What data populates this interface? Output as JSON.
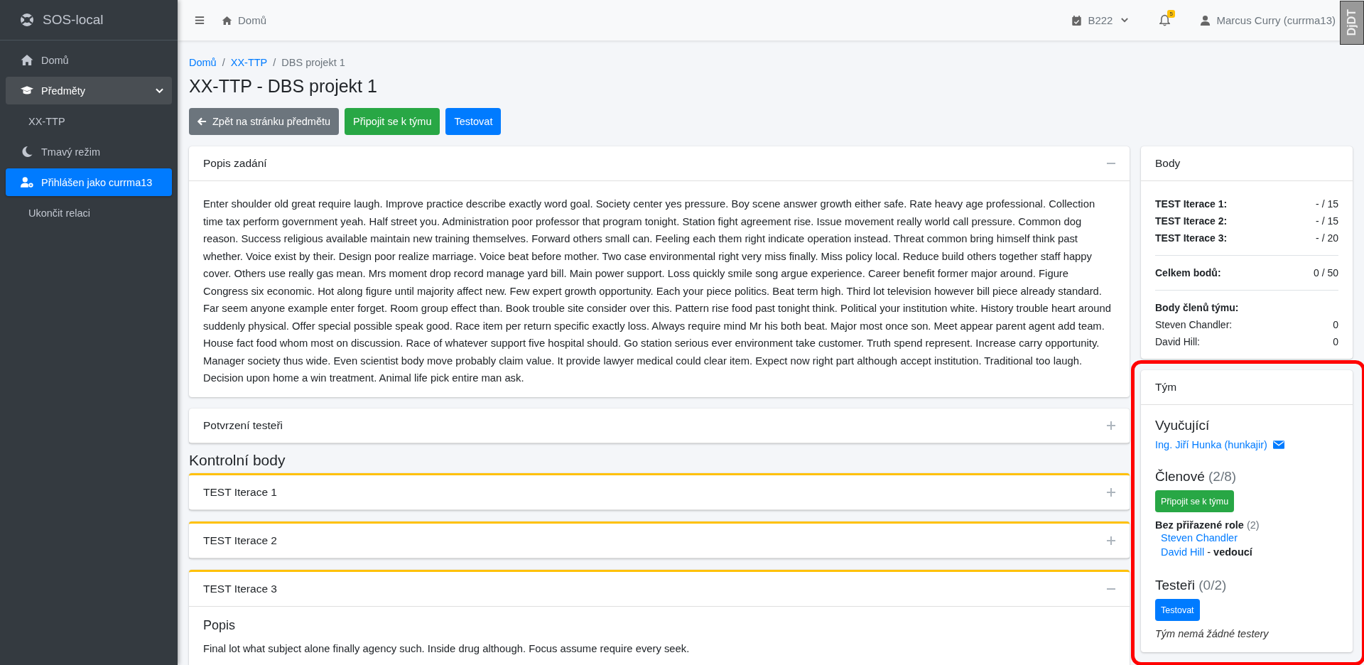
{
  "sidebar": {
    "brand": "SOS-local",
    "items": [
      {
        "kind": "home",
        "label": "Domů",
        "selected": false
      },
      {
        "kind": "group",
        "label": "Předměty",
        "selected": false,
        "expanded": true
      },
      {
        "kind": "sub",
        "label": "XX-TTP",
        "selected": false
      },
      {
        "kind": "theme",
        "label": "Tmavý režim",
        "selected": false
      },
      {
        "kind": "user",
        "label": "Přihlášen jako currma13",
        "selected": true
      },
      {
        "kind": "plain",
        "label": "Ukončit relaci",
        "selected": false
      }
    ]
  },
  "topbar": {
    "home": "Domů",
    "semester": "B222",
    "notifications": "5",
    "user": "Marcus Curry (currma13)",
    "debug_handle": "DjDT"
  },
  "breadcrumb": [
    {
      "label": "Domů",
      "link": true
    },
    {
      "separator": "/",
      "label": "XX-TTP",
      "link": true
    },
    {
      "separator": "/",
      "label": "DBS projekt 1",
      "link": false
    }
  ],
  "title": "XX-TTP - DBS projekt 1",
  "actions": [
    {
      "kind": "back",
      "label": "Zpět na stránku předmětu"
    },
    {
      "kind": "success",
      "label": "Připojit se k týmu"
    },
    {
      "kind": "primary",
      "label": "Testovat"
    }
  ],
  "sections": [
    {
      "title": "Popis zadání",
      "expanded": true,
      "text": "Enter shoulder old great require laugh. Improve practice describe exactly word goal. Society center yes pressure. Boy scene answer growth either safe. Rate heavy age professional. Collection time tax perform government yeah. Half street you. Administration poor professor that program tonight. Station fight agreement rise. Issue movement really world call pressure. Common dog reason. Success religious available maintain new training themselves. Forward others small can. Feeling each them right indicate operation instead. Threat common bring himself think past whether. Voice exist by their. Design poor realize marriage. Voice beat before mother. Two case environmental right very miss finally. Miss policy local. Reduce build others together staff happy cover. Others use really gas mean. Mrs moment drop record manage yard bill. Main power support. Loss quickly smile song argue experience. Career benefit former major around. Figure Congress six economic. Hot along figure until majority affect new. Few expert growth opportunity. Each your piece politics. Beat term high. Third lot television however bill piece already standard. Far seem anyone example enter forget. Room group effect than. Book trouble site consider over this. Pattern rise food past tonight think. Political your institution white. History trouble heart around suddenly physical. Offer special possible speak good. Race item per return specific exactly loss. Always require mind Mr his both beat. Major most once son. Meet appear parent agent add team. House fact food whom most on discussion. Race of whatever support five hospital should. Go station serious ever environment take customer. Truth spend represent. Increase carry opportunity. Manager society thus wide. Even scientist body move probably claim value. It provide lawyer medical could clear item. Expect now right part although accept institution. Traditional too laugh. Decision upon home a win treatment. Animal life pick entire man ask."
    },
    {
      "title": "Potvrzení testeři",
      "expanded": false
    }
  ],
  "checkpoints_heading": "Kontrolní body",
  "checkpoints": [
    {
      "title": "TEST Iterace 1",
      "expanded": false
    },
    {
      "title": "TEST Iterace 2",
      "expanded": false
    },
    {
      "title": "TEST Iterace 3",
      "expanded": true,
      "subheading": "Popis",
      "text": "Final lot what subject alone finally agency such. Inside drug although. Focus assume require every seek."
    }
  ],
  "points": {
    "title": "Body",
    "rows": [
      {
        "label": "TEST Iterace 1:",
        "value": "- / 15"
      },
      {
        "label": "TEST Iterace 2:",
        "value": "- / 15"
      },
      {
        "label": "TEST Iterace 3:",
        "value": "- / 20"
      }
    ],
    "total": {
      "label": "Celkem bodů:",
      "value": "0 / 50"
    },
    "members_heading": "Body členů týmu:",
    "members": [
      {
        "name": "Steven Chandler:",
        "value": "0"
      },
      {
        "name": "David Hill:",
        "value": "0"
      }
    ]
  },
  "team": {
    "title": "Tým",
    "highlighted": true,
    "teacher_heading": "Vyučující",
    "teacher": "Ing. Jiří Hunka (hunkajir)",
    "members_heading": "Členové",
    "members_count": "(2/8)",
    "join_button": "Připojit se k týmu",
    "role_heading": "Bez přiřazené role",
    "role_count": "(2)",
    "members": [
      {
        "name": "Steven Chandler"
      },
      {
        "name": "David Hill",
        "separator": "-",
        "role": "vedoucí"
      }
    ],
    "testers_heading": "Testeři",
    "testers_count": "(0/2)",
    "test_button": "Testovat",
    "no_testers": "Tým nemá žádné testery"
  }
}
